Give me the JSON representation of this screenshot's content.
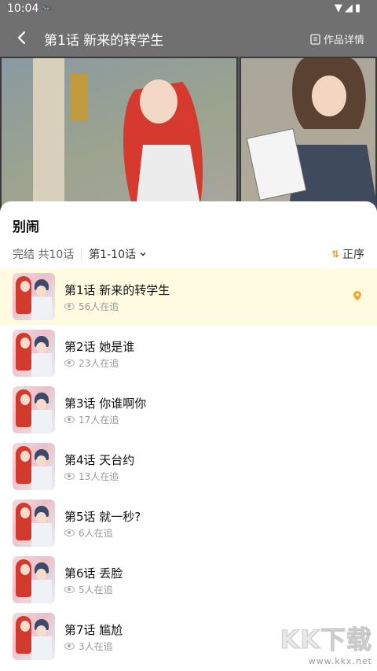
{
  "status": {
    "time": "10:04",
    "game_icon": "gamepad-icon",
    "icons": [
      "wifi-icon",
      "signal-icon",
      "battery-icon"
    ]
  },
  "appbar": {
    "title": "第1话 新来的转学生",
    "detail_label": "作品详情"
  },
  "sheet": {
    "series_title": "别闹",
    "status_text": "完结 共10话",
    "range_label": "第1-10话",
    "order_label": "正序"
  },
  "episodes": [
    {
      "title": "第1话 新来的转学生",
      "views": "56人在追",
      "current": true
    },
    {
      "title": "第2话 她是谁",
      "views": "23人在追"
    },
    {
      "title": "第3话 你谁啊你",
      "views": "17人在追"
    },
    {
      "title": "第4话 天台约",
      "views": "13人在追"
    },
    {
      "title": "第5话 就一秒?",
      "views": "6人在追"
    },
    {
      "title": "第6话 丢脸",
      "views": "5人在追"
    },
    {
      "title": "第7话 尴尬",
      "views": "3人在追"
    }
  ],
  "watermark": {
    "logo": "KK下载",
    "url": "www.kkx.net"
  },
  "colors": {
    "accent": "#f5a623",
    "active_row": "#fffbe0",
    "order_icon": "#e8a317"
  }
}
